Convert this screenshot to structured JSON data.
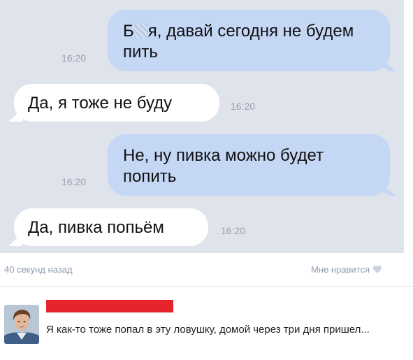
{
  "messages": [
    {
      "side": "out",
      "text_before": "Б",
      "text_after": "я, давай сегодня не будем пить",
      "time": "16:20"
    },
    {
      "side": "in",
      "text": "Да, я тоже не буду",
      "time": "16:20"
    },
    {
      "side": "out",
      "text": "Не, ну пивка можно будет попить",
      "time": "16:20"
    },
    {
      "side": "in",
      "text": "Да, пивка попьём",
      "time": "16:20"
    }
  ],
  "post_footer": {
    "timestamp": "40 секунд назад",
    "like_label": "Мне нравится"
  },
  "comment": {
    "text": "Я как-то тоже попал в эту ловушку, домой через три дня пришел..."
  },
  "colors": {
    "chat_background": "#dfe3ec",
    "outgoing_bubble": "#c4d7f5",
    "incoming_bubble": "#ffffff",
    "name_redaction": "#e5242d"
  }
}
